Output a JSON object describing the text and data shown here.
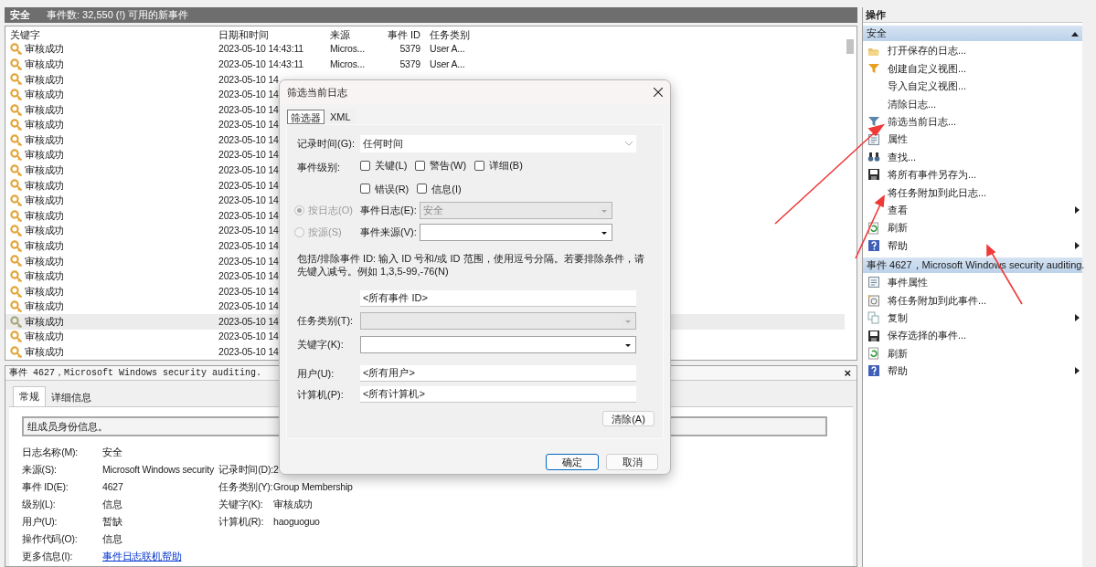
{
  "log_header": {
    "title": "安全",
    "count": "事件数: 32,550 (!) 可用的新事件"
  },
  "event_table": {
    "columns": [
      "关键字",
      "日期和时间",
      "来源",
      "事件 ID",
      "任务类别"
    ],
    "rows": [
      {
        "keyword": "审核成功",
        "datetime": "2023-05-10 14:43:11",
        "source": "Micros...",
        "event_id": "5379",
        "task_category": "User A...",
        "selected": false
      },
      {
        "keyword": "审核成功",
        "datetime": "2023-05-10 14:43:11",
        "source": "Micros...",
        "event_id": "5379",
        "task_category": "User A...",
        "selected": false
      },
      {
        "keyword": "审核成功",
        "datetime": "2023-05-10 14",
        "selected": false
      },
      {
        "keyword": "审核成功",
        "datetime": "2023-05-10 14",
        "selected": false
      },
      {
        "keyword": "审核成功",
        "datetime": "2023-05-10 14",
        "selected": false
      },
      {
        "keyword": "审核成功",
        "datetime": "2023-05-10 14",
        "selected": false
      },
      {
        "keyword": "审核成功",
        "datetime": "2023-05-10 14",
        "selected": false
      },
      {
        "keyword": "审核成功",
        "datetime": "2023-05-10 14",
        "selected": false
      },
      {
        "keyword": "审核成功",
        "datetime": "2023-05-10 14",
        "selected": false
      },
      {
        "keyword": "审核成功",
        "datetime": "2023-05-10 14",
        "selected": false
      },
      {
        "keyword": "审核成功",
        "datetime": "2023-05-10 14",
        "selected": false
      },
      {
        "keyword": "审核成功",
        "datetime": "2023-05-10 14",
        "selected": false
      },
      {
        "keyword": "审核成功",
        "datetime": "2023-05-10 14",
        "selected": false
      },
      {
        "keyword": "审核成功",
        "datetime": "2023-05-10 14",
        "selected": false
      },
      {
        "keyword": "审核成功",
        "datetime": "2023-05-10 14",
        "selected": false
      },
      {
        "keyword": "审核成功",
        "datetime": "2023-05-10 14",
        "selected": false
      },
      {
        "keyword": "审核成功",
        "datetime": "2023-05-10 14",
        "selected": false
      },
      {
        "keyword": "审核成功",
        "datetime": "2023-05-10 14",
        "selected": false
      },
      {
        "keyword": "审核成功",
        "datetime": "2023-05-10 14",
        "selected": true
      },
      {
        "keyword": "审核成功",
        "datetime": "2023-05-10 14",
        "selected": false
      },
      {
        "keyword": "审核成功",
        "datetime": "2023-05-10 14",
        "selected": false
      }
    ]
  },
  "detail_pane": {
    "title": "事件 4627，Microsoft Windows security auditing.",
    "close": "×",
    "tabs": [
      {
        "label": "常规",
        "selected": true
      },
      {
        "label": "详细信息",
        "selected": false
      }
    ],
    "description": "组成员身份信息。",
    "fields": [
      {
        "label": "日志名称(M):",
        "value": "安全"
      },
      {
        "label": "来源(S):",
        "value": "Microsoft Windows security",
        "label2": "记录时间(D):",
        "value2": "2"
      },
      {
        "label": "事件 ID(E):",
        "value": "4627",
        "label2": "任务类别(Y):",
        "value2": "Group Membership"
      },
      {
        "label": "级别(L):",
        "value": "信息",
        "label2": "关键字(K):",
        "value2": "审核成功"
      },
      {
        "label": "用户(U):",
        "value": "暂缺",
        "label2": "计算机(R):",
        "value2": "haoguoguo"
      },
      {
        "label": "操作代码(O):",
        "value": "信息"
      },
      {
        "label": "更多信息(I):",
        "value": "事件日志联机帮助",
        "kind": "link"
      }
    ]
  },
  "actions_pane": {
    "title": "操作",
    "sections": [
      {
        "title": "安全",
        "expanded": true,
        "items": [
          {
            "label": "打开保存的日志...",
            "kind": "folder",
            "submenu": false
          },
          {
            "label": "创建自定义视图...",
            "kind": "funnel",
            "submenu": false
          },
          {
            "label": "导入自定义视图...",
            "kind": "none",
            "submenu": false
          },
          {
            "label": "清除日志...",
            "kind": "none",
            "submenu": false
          },
          {
            "label": "筛选当前日志...",
            "kind": "filter",
            "submenu": false
          },
          {
            "label": "属性",
            "kind": "properties",
            "submenu": false
          },
          {
            "label": "查找...",
            "kind": "binoculars",
            "submenu": false
          },
          {
            "label": "将所有事件另存为...",
            "kind": "save",
            "submenu": false
          },
          {
            "label": "将任务附加到此日志...",
            "kind": "none",
            "submenu": false
          },
          {
            "label": "查看",
            "kind": "none",
            "submenu": true
          },
          {
            "label": "刷新",
            "kind": "refresh",
            "submenu": false
          },
          {
            "label": "帮助",
            "kind": "help",
            "submenu": true
          }
        ]
      },
      {
        "title": "事件 4627，Microsoft Windows security auditing.",
        "expanded": true,
        "items": [
          {
            "label": "事件属性",
            "kind": "properties",
            "submenu": false
          },
          {
            "label": "将任务附加到此事件...",
            "kind": "task",
            "submenu": false
          },
          {
            "label": "复制",
            "kind": "copy",
            "submenu": true
          },
          {
            "label": "保存选择的事件...",
            "kind": "save",
            "submenu": false
          },
          {
            "label": "刷新",
            "kind": "refresh",
            "submenu": false
          },
          {
            "label": "帮助",
            "kind": "help",
            "submenu": true
          }
        ]
      }
    ]
  },
  "filter_dialog": {
    "title": "筛选当前日志",
    "tabs": [
      {
        "label": "筛选器",
        "selected": true
      },
      {
        "label": "XML",
        "selected": false
      }
    ],
    "logged": {
      "label": "记录时间(G):",
      "value": "任何时间"
    },
    "event_level": {
      "label": "事件级别:",
      "options": [
        {
          "label": "关键(L)",
          "checked": false
        },
        {
          "label": "警告(W)",
          "checked": false
        },
        {
          "label": "详细(B)",
          "checked": false
        },
        {
          "label": "错误(R)",
          "checked": false
        },
        {
          "label": "信息(I)",
          "checked": false
        }
      ]
    },
    "by_log": {
      "label": "按日志(O)",
      "selected": true,
      "disabled": true
    },
    "event_log": {
      "label": "事件日志(E):",
      "value": "安全",
      "disabled": true
    },
    "by_source": {
      "label": "按源(S)",
      "selected": false,
      "disabled": true
    },
    "event_source": {
      "label": "事件来源(V):",
      "disabled": false
    },
    "hint": "包括/排除事件 ID: 输入 ID 号和/或 ID 范围，使用逗号分隔。若要排除条件，请先键入减号。例如 1,3,5-99,-76(N)",
    "event_id": {
      "value": "<所有事件 ID>"
    },
    "task_category": {
      "label": "任务类别(T):",
      "disabled": true
    },
    "keywords": {
      "label": "关键字(K):",
      "disabled": false
    },
    "user": {
      "label": "用户(U):",
      "value": "<所有用户>"
    },
    "computer": {
      "label": "计算机(P):",
      "value": "<所有计算机>"
    },
    "clear_button": "清除(A)",
    "ok_button": "确定",
    "cancel_button": "取消"
  }
}
